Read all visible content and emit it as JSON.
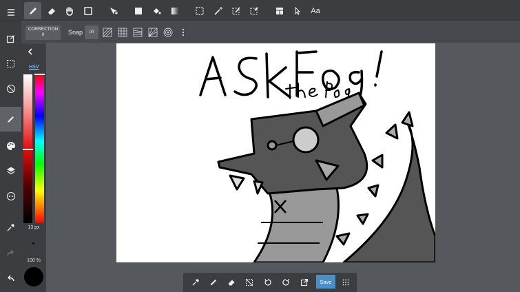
{
  "toolbar": {
    "text_tool_label": "Aa"
  },
  "subtoolbar": {
    "correction_label": "CORRECTION",
    "correction_value": "0",
    "snap_label": "Snap",
    "snap_off_label": "off"
  },
  "color_panel": {
    "mode_label": "HSV",
    "brush_size": "13 px",
    "opacity": "100 %",
    "current_color": "#000000"
  },
  "bottom_bar": {
    "save_label": "Save"
  },
  "canvas": {
    "handwritten_title": "ASKFOG!",
    "handwritten_subtitle": "the Pog"
  }
}
